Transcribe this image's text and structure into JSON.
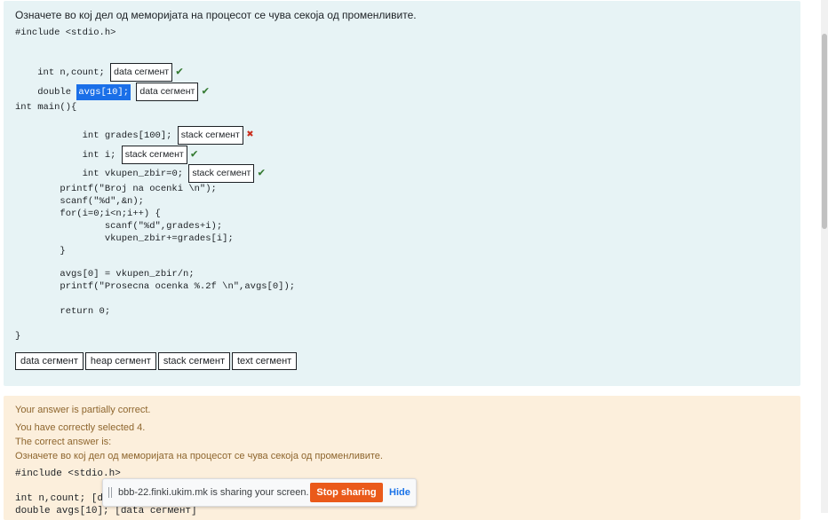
{
  "question": {
    "prompt": "Означете во кој дел од меморијата на процесот се чува секоја од променливите.",
    "include": "#include <stdio.h>",
    "line_count_pre": "int n,count; ",
    "line_count_ans": "data сегмент",
    "line_avgs_pre": "double ",
    "line_avgs_sel": "avgs[10];",
    "line_avgs_ans": "data сегмент",
    "main_open": "int main(){",
    "grades_pre": "        int grades[100];",
    "grades_ans": "stack сегмент",
    "i_pre": "        int i; ",
    "i_ans": "stack сегмент",
    "vkupen_pre": "        int vkupen_zbir=0; ",
    "vkupen_ans": "stack сегмент",
    "code1": "        printf(\"Broj na ocenki \\n\");",
    "code2": "        scanf(\"%d\",&n);",
    "code3": "        for(i=0;i<n;i++) {",
    "code4": "                scanf(\"%d\",grades+i);",
    "code5": "                vkupen_zbir+=grades[i];",
    "code6": "        }",
    "code7": "        avgs[0] = vkupen_zbir/n;",
    "code8": "        printf(\"Prosecna ocenka %.2f \\n\",avgs[0]);",
    "code9": "        return 0;",
    "main_close": "}",
    "options": [
      "data сегмент",
      "heap сегмент",
      "stack сегмент",
      "text сегмент"
    ]
  },
  "feedback": {
    "partial": "Your answer is partially correct.",
    "selected": "You have correctly selected 4.",
    "correct_label": "The correct answer is:",
    "prompt": "Означете во кој дел од меморијата на процесот се чува секоја од променливите.",
    "include": "#include <stdio.h>",
    "line1": "int n,count; [data сегмент]",
    "line2": "double avgs[10]; [data сегмент]"
  },
  "sharebar": {
    "message": "bbb-22.finki.ukim.mk is sharing your screen.",
    "stop_label": "Stop sharing",
    "hide_label": "Hide"
  },
  "colors": {
    "correct": "#357a32",
    "incorrect": "#ca3120",
    "accent": "#ea5a1a",
    "selection": "#1a6fe8"
  },
  "icons": {
    "correct": "check-icon",
    "incorrect": "cross-icon"
  }
}
